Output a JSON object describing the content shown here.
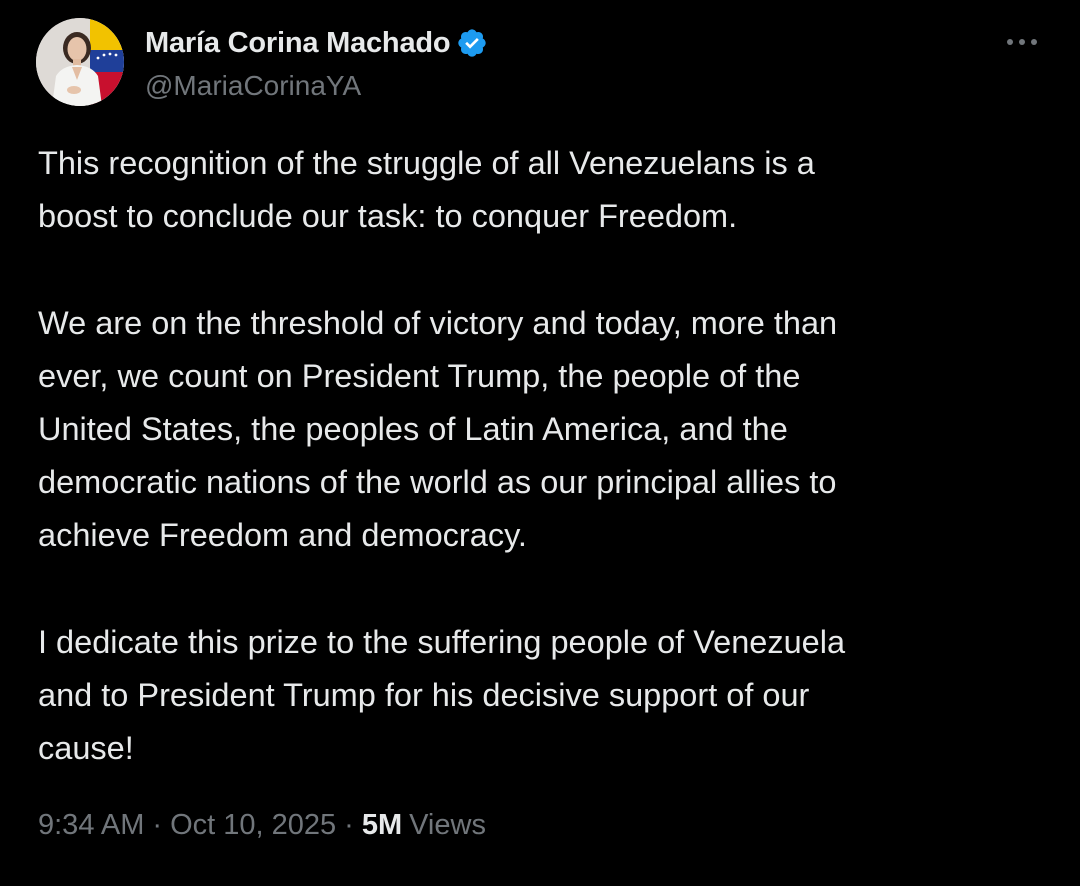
{
  "author": {
    "display_name": "María Corina Machado",
    "handle": "@MariaCorinaYA",
    "verified": true,
    "verified_color": "#1d9bf0"
  },
  "tweet": {
    "paragraphs": [
      "This recognition of the struggle of all Venezuelans is a\nboost to conclude our task: to conquer Freedom.",
      "We are on the threshold of victory and today, more than\never, we count on President Trump, the people of the\nUnited States, the peoples of Latin America, and the\ndemocratic nations of the world as our principal allies to\nachieve Freedom and democracy.",
      "I dedicate this prize to the suffering people of Venezuela\nand to President Trump for his decisive support of our\ncause!"
    ]
  },
  "meta": {
    "time": "9:34 AM",
    "separator": "·",
    "date": "Oct 10, 2025",
    "views_count": "5M",
    "views_label": "Views"
  },
  "icons": {
    "more": "more-horizontal-icon",
    "verified": "verified-badge-icon"
  },
  "colors": {
    "background": "#000000",
    "primary_text": "#e7e9ea",
    "secondary_text": "#71767b"
  }
}
